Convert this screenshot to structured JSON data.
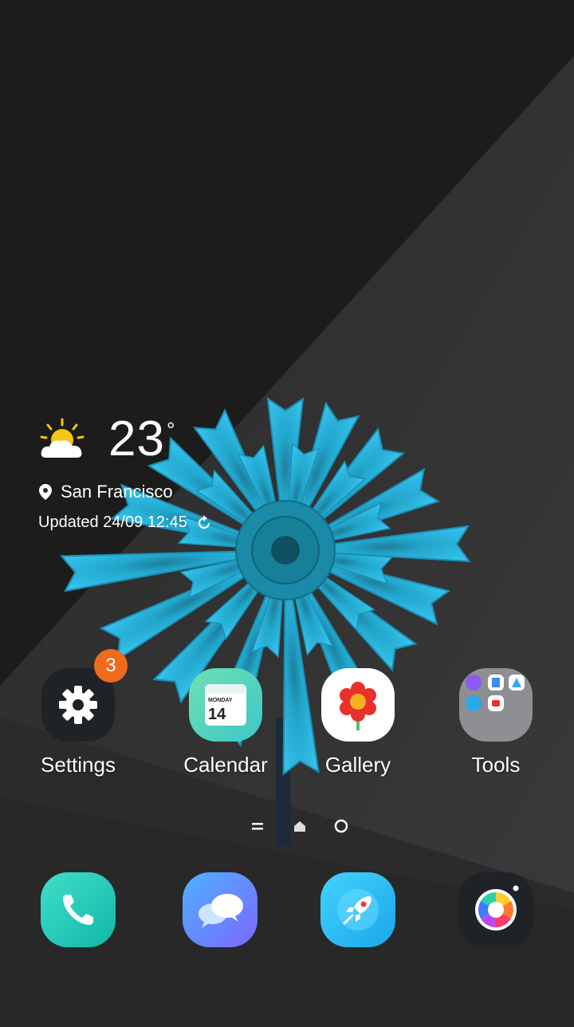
{
  "weather": {
    "temperature": "23",
    "degree": "°",
    "location": "San Francisco",
    "updated": "Updated 24/09 12:45",
    "icon": "partly-cloudy-icon"
  },
  "apps": [
    {
      "label": "Settings",
      "badge": "3",
      "icon": "gear-icon"
    },
    {
      "label": "Calendar",
      "icon": "calendar-icon",
      "day_name": "MONDAY",
      "day_number": "14"
    },
    {
      "label": "Gallery",
      "icon": "flower-icon"
    },
    {
      "label": "Tools",
      "icon": "folder-icon"
    }
  ],
  "page_indicator": {
    "pages": 3,
    "current": 2
  },
  "dock": [
    {
      "icon": "phone-icon"
    },
    {
      "icon": "messages-icon"
    },
    {
      "icon": "rocket-icon"
    },
    {
      "icon": "camera-icon"
    }
  ],
  "colors": {
    "badge": "#f06a1c",
    "petal": "#2bb3e0",
    "settings_bg": "#1f2226",
    "tools_bg": "#8d8f93"
  }
}
